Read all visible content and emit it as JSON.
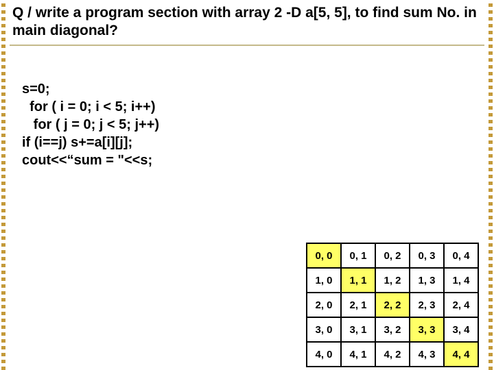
{
  "question": "Q / write a program section with array 2 -D a[5, 5], to find sum No. in main diagonal?",
  "code": "s=0;\n  for ( i = 0; i < 5; i++)\n   for ( j = 0; j < 5; j++)\nif (i==j) s+=a[i][j];\ncout<<“sum = \"<<s;",
  "grid": [
    [
      {
        "t": "0, 0",
        "d": true
      },
      {
        "t": "0, 1",
        "d": false
      },
      {
        "t": "0, 2",
        "d": false
      },
      {
        "t": "0, 3",
        "d": false
      },
      {
        "t": "0, 4",
        "d": false
      }
    ],
    [
      {
        "t": "1, 0",
        "d": false
      },
      {
        "t": "1, 1",
        "d": true
      },
      {
        "t": "1, 2",
        "d": false
      },
      {
        "t": "1, 3",
        "d": false
      },
      {
        "t": "1, 4",
        "d": false
      }
    ],
    [
      {
        "t": "2, 0",
        "d": false
      },
      {
        "t": "2, 1",
        "d": false
      },
      {
        "t": "2, 2",
        "d": true
      },
      {
        "t": "2, 3",
        "d": false
      },
      {
        "t": "2, 4",
        "d": false
      }
    ],
    [
      {
        "t": "3, 0",
        "d": false
      },
      {
        "t": "3, 1",
        "d": false
      },
      {
        "t": "3, 2",
        "d": false
      },
      {
        "t": "3, 3",
        "d": true
      },
      {
        "t": "3, 4",
        "d": false
      }
    ],
    [
      {
        "t": "4, 0",
        "d": false
      },
      {
        "t": "4, 1",
        "d": false
      },
      {
        "t": "4, 2",
        "d": false
      },
      {
        "t": "4, 3",
        "d": false
      },
      {
        "t": "4, 4",
        "d": true
      }
    ]
  ]
}
